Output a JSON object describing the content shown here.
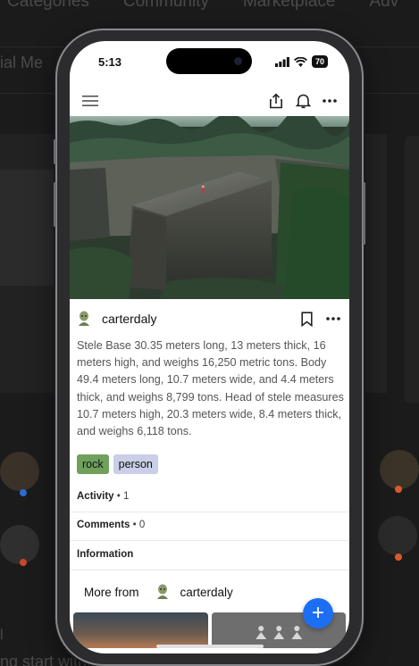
{
  "background": {
    "nav_items": [
      "Categories",
      "Community",
      "Marketplace",
      "Adv"
    ],
    "subtitle": "ial Me",
    "bottom_text": "ng start with",
    "bottom_left": "l"
  },
  "status_bar": {
    "time": "5:13",
    "battery": "70"
  },
  "app_bar": {
    "menu_icon": "menu-icon",
    "share_icon": "share-icon",
    "bell_icon": "bell-icon",
    "more_icon": "more-icon"
  },
  "post": {
    "author": "carterdaly",
    "description": "Stele Base 30.35 meters long, 13 meters thick, 16 meters high, and weighs 16,250 metric tons. Body 49.4 meters long, 10.7 meters wide, and 4.4 meters thick, and weighs 8,799 tons. Head of stele measures 10.7 meters high, 20.3 meters wide, 8.4 meters thick, and weighs 6,118 tons.",
    "tags": [
      "rock",
      "person"
    ],
    "activity_label": "Activity",
    "activity_count": "1",
    "comments_label": "Comments",
    "comments_count": "0",
    "information_label": "Information",
    "more_from_label": "More from",
    "more_from_author": "carterdaly"
  },
  "colors": {
    "tag_rock": "#6fa05c",
    "tag_person": "#c8cfe6",
    "fab": "#1c6ff5"
  }
}
